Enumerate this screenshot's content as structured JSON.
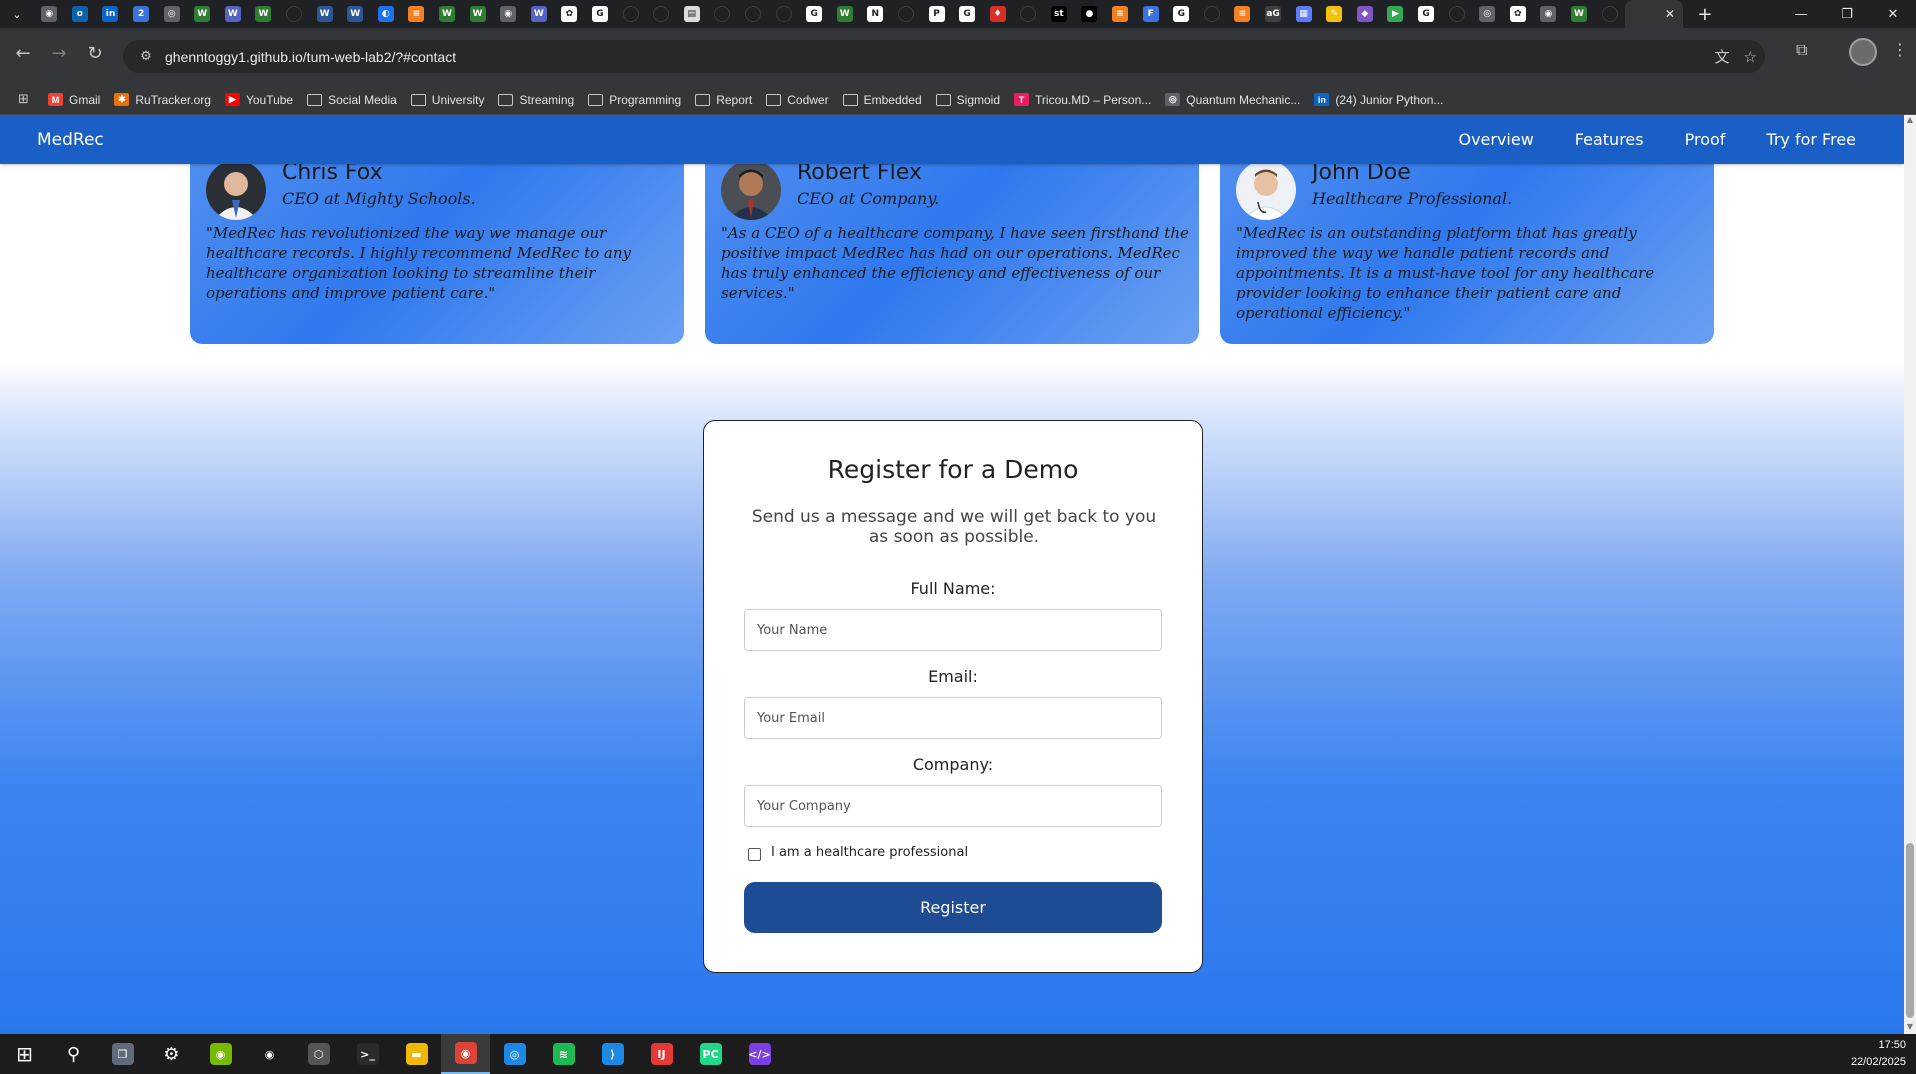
{
  "browser": {
    "tabs": [
      {
        "icon": "chrome-icon",
        "color": "#5f6368",
        "glyph": "◉"
      },
      {
        "icon": "outlook-icon",
        "color": "#0a64ad",
        "glyph": "o"
      },
      {
        "icon": "linkedin-icon",
        "color": "#0a66c2",
        "glyph": "in"
      },
      {
        "icon": "number-icon",
        "color": "#3b73d9",
        "glyph": "2"
      },
      {
        "icon": "globe-icon",
        "color": "#5f6368",
        "glyph": "◎"
      },
      {
        "icon": "w-icon",
        "color": "#2e7d32",
        "glyph": "W"
      },
      {
        "icon": "w-icon",
        "color": "#5563c1",
        "glyph": "W"
      },
      {
        "icon": "w-icon",
        "color": "#2e7d32",
        "glyph": "W"
      },
      {
        "icon": "blank-icon",
        "color": "#202124",
        "glyph": ""
      },
      {
        "icon": "word-icon",
        "color": "#2b5797",
        "glyph": "W"
      },
      {
        "icon": "word-icon",
        "color": "#2b5797",
        "glyph": "W"
      },
      {
        "icon": "shield-icon",
        "color": "#1a73e8",
        "glyph": "◐"
      },
      {
        "icon": "stack-icon",
        "color": "#f48024",
        "glyph": "≡"
      },
      {
        "icon": "w-icon",
        "color": "#2e7d32",
        "glyph": "W"
      },
      {
        "icon": "w-icon",
        "color": "#2e7d32",
        "glyph": "W"
      },
      {
        "icon": "chrome-icon",
        "color": "#5f6368",
        "glyph": "◉"
      },
      {
        "icon": "w-icon",
        "color": "#5563c1",
        "glyph": "W"
      },
      {
        "icon": "openai-icon",
        "color": "#ffffff",
        "glyph": "✿"
      },
      {
        "icon": "google-icon",
        "color": "#ffffff",
        "glyph": "G"
      },
      {
        "icon": "blank-icon",
        "color": "#202124",
        "glyph": ""
      },
      {
        "icon": "blank-icon",
        "color": "#202124",
        "glyph": ""
      },
      {
        "icon": "doc-icon",
        "color": "#dcdcdc",
        "glyph": "▤"
      },
      {
        "icon": "blank-icon",
        "color": "#202124",
        "glyph": ""
      },
      {
        "icon": "blank-icon",
        "color": "#202124",
        "glyph": ""
      },
      {
        "icon": "blank-icon",
        "color": "#202124",
        "glyph": ""
      },
      {
        "icon": "google-icon",
        "color": "#ffffff",
        "glyph": "G"
      },
      {
        "icon": "w-icon",
        "color": "#2e7d32",
        "glyph": "W"
      },
      {
        "icon": "notion-icon",
        "color": "#ffffff",
        "glyph": "N"
      },
      {
        "icon": "blank-icon",
        "color": "#202124",
        "glyph": ""
      },
      {
        "icon": "p-icon",
        "color": "#ffffff",
        "glyph": "P"
      },
      {
        "icon": "google-icon",
        "color": "#ffffff",
        "glyph": "G"
      },
      {
        "icon": "drop-icon",
        "color": "#d93025",
        "glyph": "♦"
      },
      {
        "icon": "blank-icon",
        "color": "#202124",
        "glyph": ""
      },
      {
        "icon": "st-icon",
        "color": "#000000",
        "glyph": "st"
      },
      {
        "icon": "github-icon",
        "color": "#000000",
        "glyph": "●"
      },
      {
        "icon": "stack-icon",
        "color": "#f48024",
        "glyph": "≡"
      },
      {
        "icon": "forms-icon",
        "color": "#3b73d9",
        "glyph": "F"
      },
      {
        "icon": "google-icon",
        "color": "#ffffff",
        "glyph": "G"
      },
      {
        "icon": "blank-icon",
        "color": "#202124",
        "glyph": ""
      },
      {
        "icon": "stack-icon",
        "color": "#f48024",
        "glyph": "≡"
      },
      {
        "icon": "ag-icon",
        "color": "#3c4043",
        "glyph": "aG"
      },
      {
        "icon": "img-icon",
        "color": "#5c7cfa",
        "glyph": "▦"
      },
      {
        "icon": "note-icon",
        "color": "#f4c20d",
        "glyph": "✎"
      },
      {
        "icon": "gem-icon",
        "color": "#7e57c2",
        "glyph": "◆"
      },
      {
        "icon": "play-icon",
        "color": "#34a853",
        "glyph": "▶"
      },
      {
        "icon": "google-icon",
        "color": "#ffffff",
        "glyph": "G"
      },
      {
        "icon": "blank-icon",
        "color": "#202124",
        "glyph": ""
      },
      {
        "icon": "globe-icon",
        "color": "#5f6368",
        "glyph": "◎"
      },
      {
        "icon": "openai-icon",
        "color": "#ffffff",
        "glyph": "✿"
      },
      {
        "icon": "chrome-icon",
        "color": "#5f6368",
        "glyph": "◉"
      },
      {
        "icon": "w-icon",
        "color": "#2e7d32",
        "glyph": "W"
      },
      {
        "icon": "blank-icon",
        "color": "#202124",
        "glyph": ""
      }
    ],
    "url": "ghenntoggy1.github.io/tum-web-lab2/?#contact",
    "bookmarks": [
      {
        "label": "Gmail",
        "kind": "icon",
        "icon": "gmail-icon",
        "color": "#ea4335",
        "glyph": "M"
      },
      {
        "label": "RuTracker.org",
        "kind": "icon",
        "icon": "rutracker-icon",
        "color": "#e8710a",
        "glyph": "✱"
      },
      {
        "label": "YouTube",
        "kind": "icon",
        "icon": "youtube-icon",
        "color": "#ff0000",
        "glyph": "▶"
      },
      {
        "label": "Social Media",
        "kind": "folder"
      },
      {
        "label": "University",
        "kind": "folder"
      },
      {
        "label": "Streaming",
        "kind": "folder"
      },
      {
        "label": "Programming",
        "kind": "folder"
      },
      {
        "label": "Report",
        "kind": "folder"
      },
      {
        "label": "Codwer",
        "kind": "folder"
      },
      {
        "label": "Embedded",
        "kind": "folder"
      },
      {
        "label": "Sigmoid",
        "kind": "folder"
      },
      {
        "label": "Tricou.MD – Person...",
        "kind": "icon",
        "icon": "tricou-icon",
        "color": "#e91e63",
        "glyph": "T"
      },
      {
        "label": "Quantum Mechanic...",
        "kind": "icon",
        "icon": "globe-icon",
        "color": "#5f6368",
        "glyph": "◎"
      },
      {
        "label": "(24) Junior Python...",
        "kind": "icon",
        "icon": "linkedin-icon",
        "color": "#0a66c2",
        "glyph": "in"
      }
    ]
  },
  "site": {
    "brand": "MedRec",
    "nav": [
      "Overview",
      "Features",
      "Proof",
      "Try for Free"
    ],
    "testimonials": [
      {
        "name": "Chris Fox",
        "role": "CEO at Mighty Schools.",
        "quote": "\"MedRec has revolutionized the way we manage our healthcare records. I highly recommend MedRec to any healthcare organization looking to streamline their operations and improve patient care.\""
      },
      {
        "name": "Robert Flex",
        "role": "CEO at Company.",
        "quote": "\"As a CEO of a healthcare company, I have seen firsthand the positive impact MedRec has had on our operations. MedRec has truly enhanced the efficiency and effectiveness of our services.\""
      },
      {
        "name": "John Doe",
        "role": "Healthcare Professional.",
        "quote": "\"MedRec is an outstanding platform that has greatly improved the way we handle patient records and appointments. It is a must-have tool for any healthcare provider looking to enhance their patient care and operational efficiency.\""
      }
    ],
    "form": {
      "title": "Register for a Demo",
      "subtitle": "Send us a message and we will get back to you as soon as possible.",
      "name_label": "Full Name:",
      "name_placeholder": "Your Name",
      "email_label": "Email:",
      "email_placeholder": "Your Email",
      "company_label": "Company:",
      "company_placeholder": "Your Company",
      "checkbox_label": "I am a healthcare professional",
      "submit": "Register"
    }
  },
  "taskbar": {
    "icons": [
      {
        "icon": "windows-start-icon",
        "color": "#1c1c1c",
        "glyph": "⊞"
      },
      {
        "icon": "search-icon",
        "color": "#1c1c1c",
        "glyph": "⚲"
      },
      {
        "icon": "task-view-icon",
        "color": "#5f6b7a",
        "glyph": "❐"
      },
      {
        "icon": "settings-icon",
        "color": "#1c1c1c",
        "glyph": "⚙"
      },
      {
        "icon": "nvidia-icon",
        "color": "#76b900",
        "glyph": "◉"
      },
      {
        "icon": "nvidia-icon",
        "color": "#1c1c1c",
        "glyph": "◉"
      },
      {
        "icon": "app-icon",
        "color": "#555555",
        "glyph": "⬡"
      },
      {
        "icon": "terminal-icon",
        "color": "#2b2b2b",
        "glyph": ">_"
      },
      {
        "icon": "file-explorer-icon",
        "color": "#f2b705",
        "glyph": "▬"
      },
      {
        "icon": "chrome-icon",
        "color": "#db4437",
        "glyph": "◉"
      },
      {
        "icon": "compass-icon",
        "color": "#1e88e5",
        "glyph": "◎"
      },
      {
        "icon": "spotify-icon",
        "color": "#1db954",
        "glyph": "≋"
      },
      {
        "icon": "vscode-icon",
        "color": "#1e88e5",
        "glyph": "⟩"
      },
      {
        "icon": "intellij-icon",
        "color": "#e53935",
        "glyph": "IJ"
      },
      {
        "icon": "pycharm-icon",
        "color": "#21d789",
        "glyph": "PC"
      },
      {
        "icon": "dev-icon",
        "color": "#7b3fe4",
        "glyph": "</>"
      }
    ],
    "time": "17:50",
    "date": "22/02/2025"
  }
}
